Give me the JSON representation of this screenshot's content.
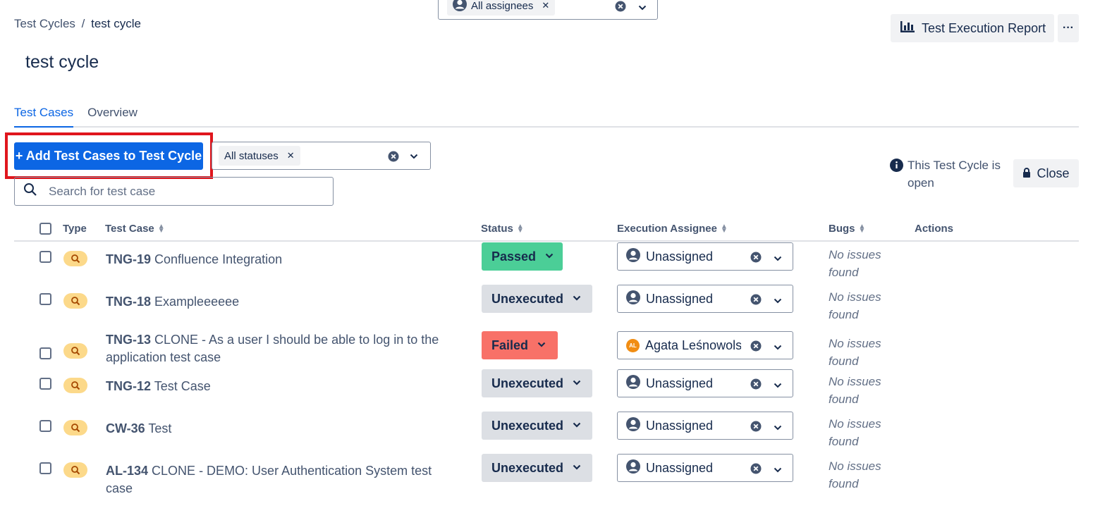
{
  "breadcrumb": {
    "parent": "Test Cycles",
    "separator": "/",
    "current": "test cycle"
  },
  "page": {
    "title": "test cycle"
  },
  "header": {
    "report_label": "Test Execution Report",
    "more_label": "···"
  },
  "tabs": [
    {
      "label": "Test Cases",
      "active": true
    },
    {
      "label": "Overview",
      "active": false
    }
  ],
  "toolbar": {
    "add_label": "+ Add Test Cases to Test Cycle",
    "status_filter": "All statuses",
    "assignee_filter": "All assignees",
    "search_placeholder": "Search for test case",
    "open_info": "This Test Cycle is open",
    "close_label": "Close"
  },
  "table": {
    "headers": {
      "type": "Type",
      "test_case": "Test Case",
      "status": "Status",
      "assignee": "Execution Assignee",
      "bugs": "Bugs",
      "actions": "Actions"
    },
    "rows": [
      {
        "key": "TNG-19",
        "title": "Confluence Integration",
        "status": "Passed",
        "status_kind": "passed",
        "assignee": "Unassigned",
        "assignee_kind": "unassigned",
        "bugs": "No issues found"
      },
      {
        "key": "TNG-18",
        "title": "Exampleeeeee",
        "status": "Unexecuted",
        "status_kind": "unexecuted",
        "assignee": "Unassigned",
        "assignee_kind": "unassigned",
        "bugs": "No issues found"
      },
      {
        "key": "TNG-13",
        "title": "CLONE - As a user I should be able to log in to the application test case",
        "status": "Failed",
        "status_kind": "failed",
        "assignee": "Agata Leśnowolsl",
        "assignee_kind": "user",
        "assignee_initials": "AL",
        "bugs": "No issues found"
      },
      {
        "key": "TNG-12",
        "title": "Test Case",
        "status": "Unexecuted",
        "status_kind": "unexecuted",
        "assignee": "Unassigned",
        "assignee_kind": "unassigned",
        "bugs": "No issues found"
      },
      {
        "key": "CW-36",
        "title": "Test",
        "status": "Unexecuted",
        "status_kind": "unexecuted",
        "assignee": "Unassigned",
        "assignee_kind": "unassigned",
        "bugs": "No issues found"
      },
      {
        "key": "AL-134",
        "title": "CLONE - DEMO: User Authentication System test case",
        "status": "Unexecuted",
        "status_kind": "unexecuted",
        "assignee": "Unassigned",
        "assignee_kind": "unassigned",
        "bugs": "No issues found"
      }
    ]
  },
  "colors": {
    "primary": "#0c66e4",
    "passed": "#4bce97",
    "failed": "#f87168",
    "unexecuted": "#dcdfe4",
    "highlight": "#e0161d",
    "type_badge": "#fcd98a",
    "avatar_al": "#f18d13"
  },
  "icons": {
    "report": "bar-chart-icon",
    "more": "more-horizontal-icon",
    "search": "search-icon",
    "info": "info-icon",
    "lock": "lock-icon",
    "type": "magnifier-test-icon",
    "user": "user-avatar-icon",
    "clear": "clear-circle-icon",
    "chevron": "chevron-down-icon",
    "sort": "sort-icon"
  }
}
